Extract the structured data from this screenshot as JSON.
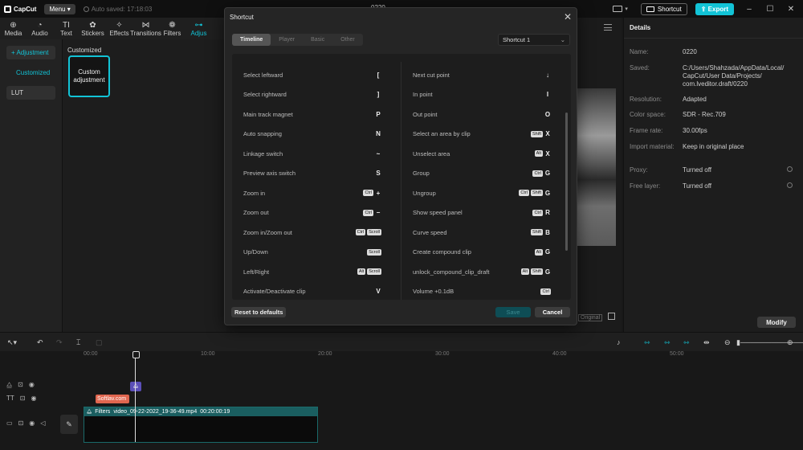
{
  "titlebar": {
    "app_name": "CapCut",
    "menu_label": "Menu",
    "autosave": "Auto saved: 17:18:03",
    "project_title": "0220",
    "shortcut_label": "Shortcut",
    "export_label": "Export"
  },
  "toolbar": [
    {
      "label": "Media",
      "icon": "media-icon"
    },
    {
      "label": "Audio",
      "icon": "audio-icon"
    },
    {
      "label": "Text",
      "icon": "text-icon"
    },
    {
      "label": "Stickers",
      "icon": "stickers-icon"
    },
    {
      "label": "Effects",
      "icon": "effects-icon"
    },
    {
      "label": "Transitions",
      "icon": "transitions-icon"
    },
    {
      "label": "Filters",
      "icon": "filters-icon"
    },
    {
      "label": "Adjus",
      "icon": "adjustment-icon"
    }
  ],
  "leftnav": {
    "adjustment": "+ Adjustment",
    "customized": "Customized",
    "lut": "LUT"
  },
  "leftcontent": {
    "section_label": "Customized",
    "card_label": "Custom adjustment"
  },
  "details": {
    "title": "Details",
    "rows": [
      {
        "label": "Name:",
        "value": "0220"
      },
      {
        "label": "Saved:",
        "value": "C:/Users/Shahzada/AppData/Local/ CapCut/User Data/Projects/ com.lveditor.draft/0220"
      },
      {
        "label": "Resolution:",
        "value": "Adapted"
      },
      {
        "label": "Color space:",
        "value": "SDR - Rec.709"
      },
      {
        "label": "Frame rate:",
        "value": "30.00fps"
      },
      {
        "label": "Import material:",
        "value": "Keep in original place"
      },
      {
        "label": "Proxy:",
        "value": "Turned off"
      },
      {
        "label": "Free layer:",
        "value": "Turned off"
      }
    ],
    "modify_label": "Modify"
  },
  "player": {
    "original_tag": "Original"
  },
  "timeline": {
    "ticks": [
      "00:00",
      "10:00",
      "20:00",
      "30:00",
      "40:00",
      "50:00"
    ],
    "text_clip": "Softlav.com",
    "video_clip_filter": "Filters",
    "video_clip_name": "video_09-22-2022_19-36-49.mp4",
    "video_clip_duration": "00:20:00:19"
  },
  "modal": {
    "title": "Shortcut",
    "tabs": [
      "Timeline",
      "Player",
      "Basic",
      "Other"
    ],
    "selected_tab": "Timeline",
    "preset": "Shortcut 1",
    "left_column": [
      {
        "name": "Select leftward",
        "keys": [
          {
            "t": "k",
            "v": "["
          }
        ]
      },
      {
        "name": "Select rightward",
        "keys": [
          {
            "t": "k",
            "v": "]"
          }
        ]
      },
      {
        "name": "Main track magnet",
        "keys": [
          {
            "t": "k",
            "v": "P"
          }
        ]
      },
      {
        "name": "Auto snapping",
        "keys": [
          {
            "t": "k",
            "v": "N"
          }
        ]
      },
      {
        "name": "Linkage switch",
        "keys": [
          {
            "t": "k",
            "v": "~"
          }
        ]
      },
      {
        "name": "Preview axis switch",
        "keys": [
          {
            "t": "k",
            "v": "S"
          }
        ]
      },
      {
        "name": "Zoom in",
        "keys": [
          {
            "t": "b",
            "v": "Ctrl"
          },
          {
            "t": "k",
            "v": "+"
          }
        ]
      },
      {
        "name": "Zoom out",
        "keys": [
          {
            "t": "b",
            "v": "Ctrl"
          },
          {
            "t": "k",
            "v": "−"
          }
        ]
      },
      {
        "name": "Zoom in/Zoom out",
        "keys": [
          {
            "t": "b",
            "v": "Ctrl"
          },
          {
            "t": "b",
            "v": "Scroll"
          }
        ]
      },
      {
        "name": "Up/Down",
        "keys": [
          {
            "t": "b",
            "v": "Scroll"
          }
        ]
      },
      {
        "name": "Left/Right",
        "keys": [
          {
            "t": "b",
            "v": "Alt"
          },
          {
            "t": "b",
            "v": "Scroll"
          }
        ]
      },
      {
        "name": "Activate/Deactivate clip",
        "keys": [
          {
            "t": "k",
            "v": "V"
          }
        ]
      }
    ],
    "right_column": [
      {
        "name": "Next cut point",
        "keys": [
          {
            "t": "k",
            "v": "↓"
          }
        ]
      },
      {
        "name": "In point",
        "keys": [
          {
            "t": "k",
            "v": "I"
          }
        ]
      },
      {
        "name": "Out point",
        "keys": [
          {
            "t": "k",
            "v": "O"
          }
        ]
      },
      {
        "name": "Select an area by clip",
        "keys": [
          {
            "t": "b",
            "v": "Shift"
          },
          {
            "t": "k",
            "v": "X"
          }
        ]
      },
      {
        "name": "Unselect area",
        "keys": [
          {
            "t": "b",
            "v": "Alt"
          },
          {
            "t": "k",
            "v": "X"
          }
        ]
      },
      {
        "name": "Group",
        "keys": [
          {
            "t": "b",
            "v": "Ctrl"
          },
          {
            "t": "k",
            "v": "G"
          }
        ]
      },
      {
        "name": "Ungroup",
        "keys": [
          {
            "t": "b",
            "v": "Ctrl"
          },
          {
            "t": "b",
            "v": "Shift"
          },
          {
            "t": "k",
            "v": "G"
          }
        ]
      },
      {
        "name": "Show speed panel",
        "keys": [
          {
            "t": "b",
            "v": "Ctrl"
          },
          {
            "t": "k",
            "v": "R"
          }
        ]
      },
      {
        "name": "Curve speed",
        "keys": [
          {
            "t": "b",
            "v": "Shift"
          },
          {
            "t": "k",
            "v": "B"
          }
        ]
      },
      {
        "name": "Create compound clip",
        "keys": [
          {
            "t": "b",
            "v": "Alt"
          },
          {
            "t": "k",
            "v": "G"
          }
        ]
      },
      {
        "name": "unlock_compound_clip_draft",
        "keys": [
          {
            "t": "b",
            "v": "Alt"
          },
          {
            "t": "b",
            "v": "Shift"
          },
          {
            "t": "k",
            "v": "G"
          }
        ]
      },
      {
        "name": "Volume +0.1dB",
        "keys": [
          {
            "t": "b",
            "v": "Ctrl"
          }
        ]
      }
    ],
    "reset_label": "Reset to defaults",
    "save_label": "Save",
    "cancel_label": "Cancel"
  },
  "colors": {
    "accent": "#12c3d6",
    "background": "#181818",
    "panel": "#1d1d1d"
  }
}
